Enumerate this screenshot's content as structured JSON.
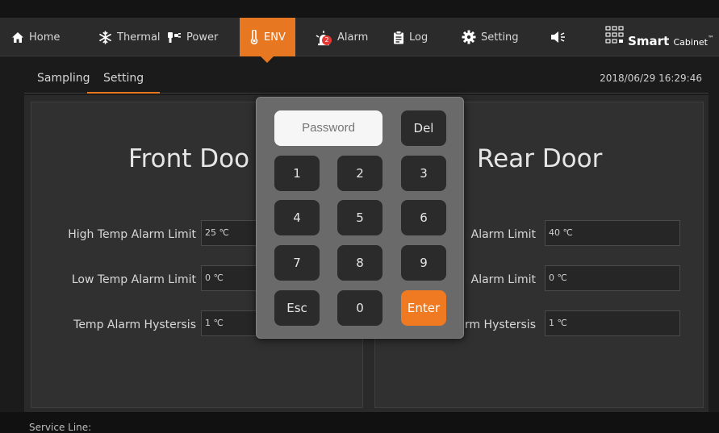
{
  "nav": {
    "items": [
      {
        "label": "Home",
        "icon": "home-icon"
      },
      {
        "label": "Thermal",
        "icon": "snowflake-icon"
      },
      {
        "label": "Power",
        "icon": "power-plug-icon"
      },
      {
        "label": "ENV",
        "icon": "thermometer-icon",
        "active": true
      },
      {
        "label": "Alarm",
        "icon": "alarm-siren-icon",
        "badge": "2"
      },
      {
        "label": "Log",
        "icon": "clipboard-icon"
      },
      {
        "label": "Setting",
        "icon": "gear-icon"
      }
    ],
    "sound_icon": "speaker-icon",
    "brand": {
      "strong": "Smart",
      "small": "Cabinet",
      "tm": "™"
    },
    "accent": "#e87722"
  },
  "subtabs": [
    {
      "label": "Sampling"
    },
    {
      "label": "Setting",
      "active": true
    }
  ],
  "datetime": "2018/06/29 16:29:46",
  "front": {
    "title": "Front Doo",
    "rows": [
      {
        "label": "High Temp Alarm Limit",
        "value": "25 ℃"
      },
      {
        "label": "Low Temp Alarm Limit",
        "value": "0 ℃"
      },
      {
        "label": "Temp Alarm Hystersis",
        "value": "1 ℃"
      }
    ]
  },
  "rear": {
    "title": "Rear Door",
    "rows": [
      {
        "label": "Alarm Limit",
        "value": "40 ℃"
      },
      {
        "label": "Alarm Limit",
        "value": "0 ℃"
      },
      {
        "label": "rm Hystersis",
        "value": "1 ℃"
      }
    ]
  },
  "keypad": {
    "placeholder": "Password",
    "keys": {
      "del": "Del",
      "k1": "1",
      "k2": "2",
      "k3": "3",
      "k4": "4",
      "k5": "5",
      "k6": "6",
      "k7": "7",
      "k8": "8",
      "k9": "9",
      "esc": "Esc",
      "k0": "0",
      "enter": "Enter"
    }
  },
  "footer": {
    "service_line": "Service Line:"
  }
}
